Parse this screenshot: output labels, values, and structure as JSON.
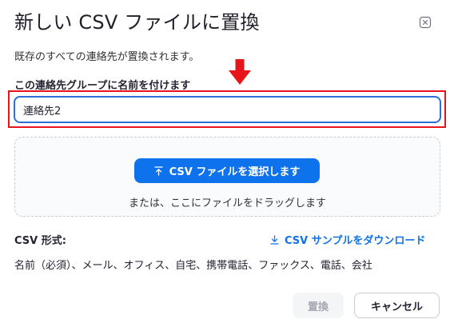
{
  "dialog": {
    "title": "新しい CSV ファイルに置換",
    "description": "既存のすべての連絡先が置換されます。",
    "group_name_label": "この連絡先グループに名前を付けます",
    "group_name_value": "連絡先2",
    "select_button_label": "CSV ファイルを選択します",
    "drop_text": "または、ここにファイルをドラッグします",
    "format_label": "CSV 形式:",
    "download_link_label": "CSV サンプルをダウンロード",
    "format_fields": "名前（必須）、メール、オフィス、自宅、携帯電話、ファックス、電話、会社",
    "replace_button": "置換",
    "cancel_button": "キャンセル"
  },
  "colors": {
    "accent": "#0e72ed",
    "highlight": "#e8141b",
    "input_border": "#2d6fd6"
  },
  "icons": {
    "close": "close-icon",
    "upload": "upload-icon",
    "download": "download-icon",
    "annotation_arrow": "arrow-down-icon"
  }
}
